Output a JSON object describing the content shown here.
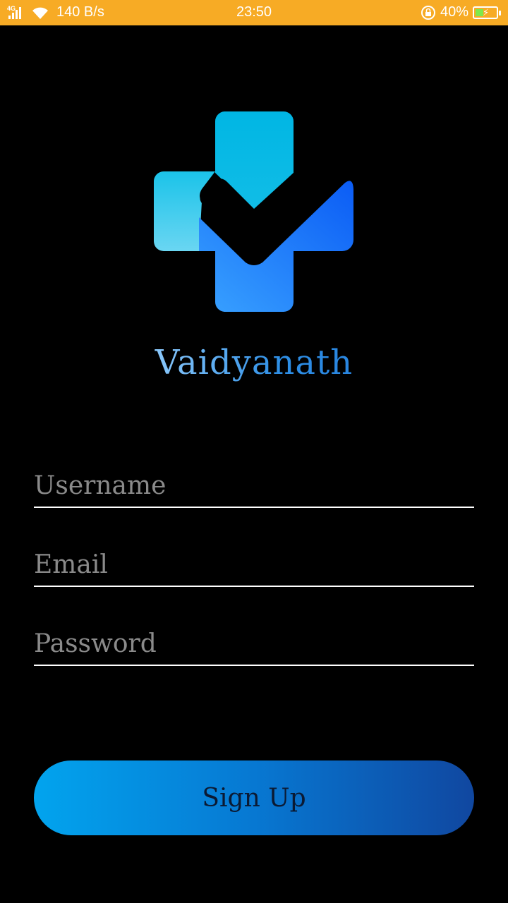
{
  "status_bar": {
    "network_type": "4G",
    "data_speed": "140 B/s",
    "time": "23:50",
    "battery_percent": "40%",
    "battery_level": 0.4,
    "icons": [
      "signal-icon",
      "wifi-icon",
      "rotation-lock-icon",
      "battery-charging-icon"
    ]
  },
  "app": {
    "name": "Vaidyanath",
    "logo": "medical-cross-check-logo"
  },
  "form": {
    "username_placeholder": "Username",
    "email_placeholder": "Email",
    "password_placeholder": "Password",
    "username_value": "",
    "email_value": "",
    "password_value": ""
  },
  "buttons": {
    "signup_label": "Sign Up"
  },
  "colors": {
    "status_bar_bg": "#f7ab25",
    "background": "#000000",
    "accent_light": "#00b4e6",
    "accent_dark": "#1047a0",
    "placeholder": "#8a8a8a"
  }
}
